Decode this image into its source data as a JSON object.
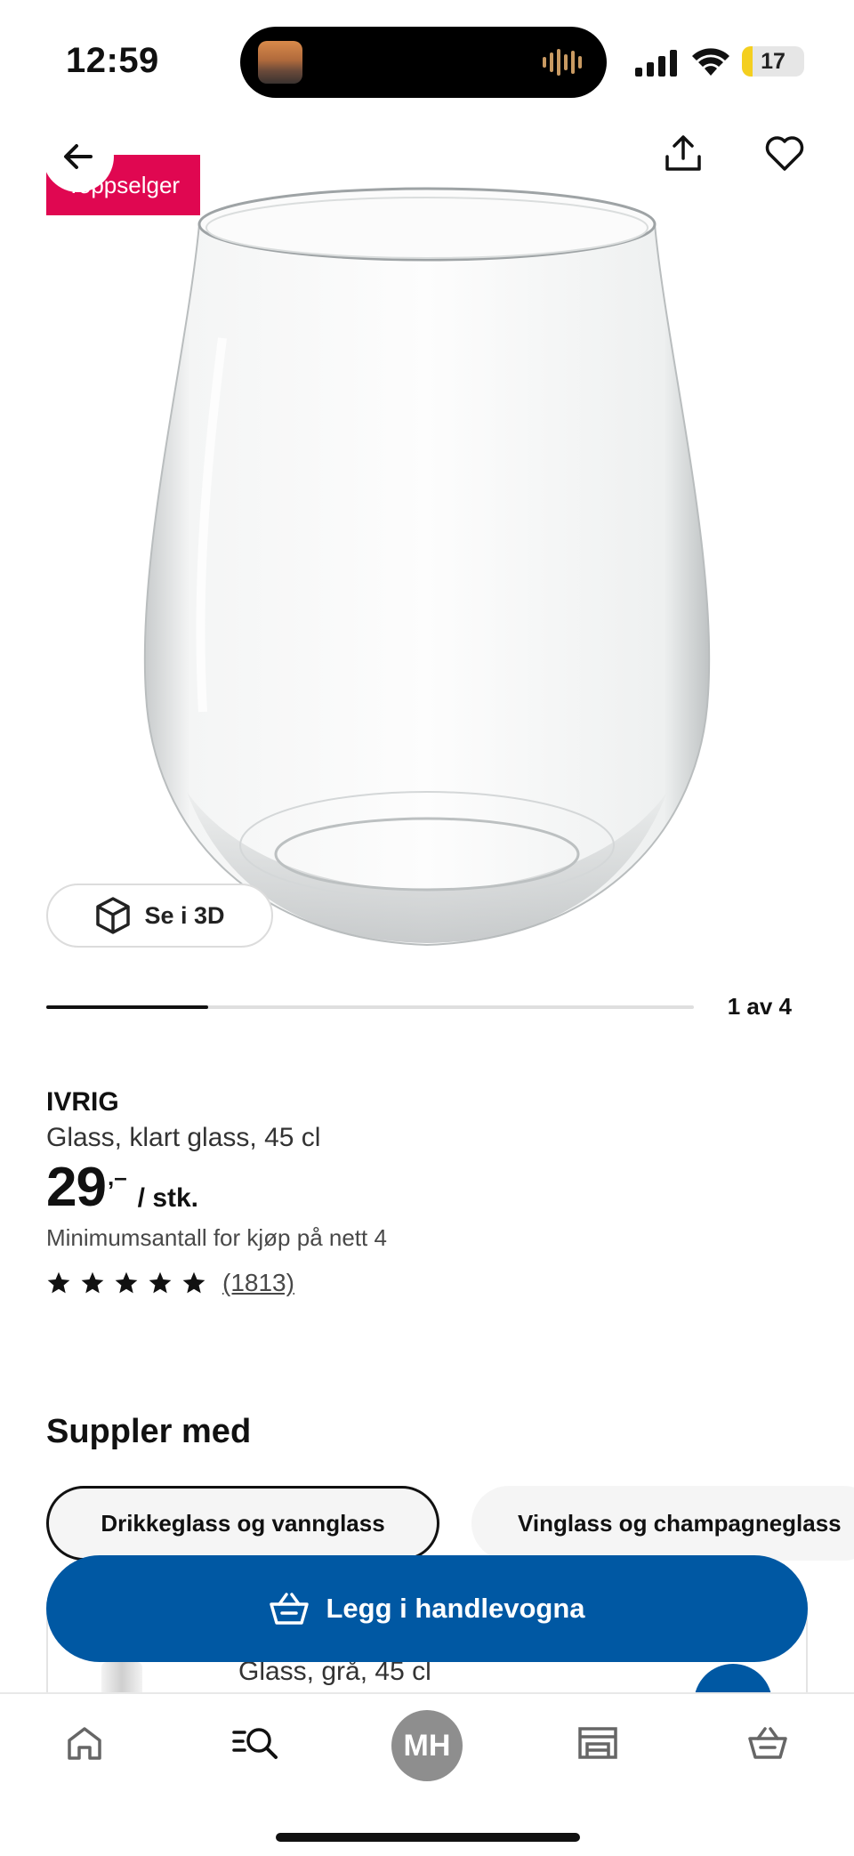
{
  "status_bar": {
    "time": "12:59",
    "battery_level": "17",
    "battery_fraction": 0.17,
    "icons": [
      "signal-icon",
      "wifi-icon",
      "battery-icon"
    ]
  },
  "top_nav": {
    "icons": [
      "back-arrow-icon",
      "share-icon",
      "heart-icon"
    ]
  },
  "product": {
    "badge": "Toppselger",
    "name": "IVRIG",
    "description": "Glass, klart glass, 45 cl",
    "price_int": "29",
    "price_dec": ",–",
    "price_unit": "/ stk.",
    "min_qty": "Minimumsantall for kjøp på nett 4",
    "rating": 5,
    "review_count": "(1813)",
    "view_3d": "Se i 3D"
  },
  "carousel": {
    "counter": "1 av 4",
    "current": 1,
    "total": 4
  },
  "supplement": {
    "title": "Suppler med",
    "chips": [
      "Drikkeglass og vannglass",
      "Vinglass og champagneglass"
    ],
    "card_description": "Glass, grå, 45 cl"
  },
  "cart": {
    "label": "Legg i handlevogna"
  },
  "tabbar": {
    "avatar_initials": "MH",
    "tabs": [
      "home-icon",
      "search-icon",
      "profile-avatar",
      "store-icon",
      "cart-icon"
    ]
  },
  "colors": {
    "brand_blue": "#0058a3",
    "badge_pink": "#e00751",
    "battery_yellow": "#f4cf1f"
  }
}
